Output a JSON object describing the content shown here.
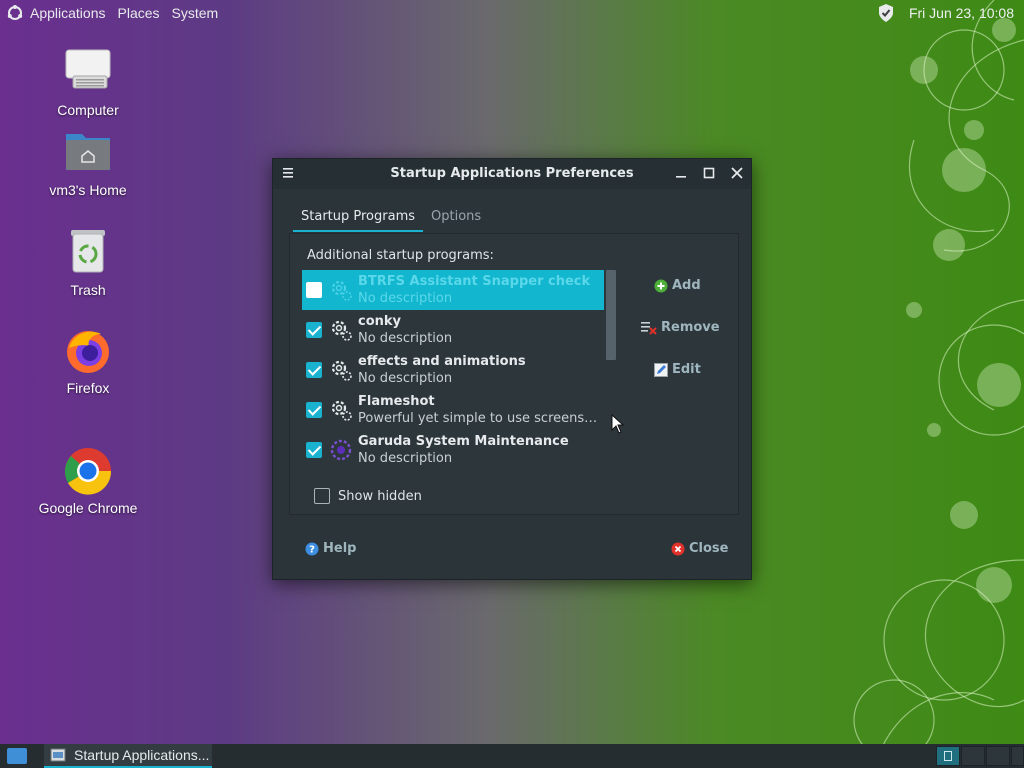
{
  "top_panel": {
    "menus": [
      "Applications",
      "Places",
      "System"
    ],
    "clock": "Fri Jun 23, 10:08"
  },
  "desktop_icons": [
    {
      "label": "Computer"
    },
    {
      "label": "vm3's Home"
    },
    {
      "label": "Trash"
    },
    {
      "label": "Firefox"
    },
    {
      "label": "Google Chrome"
    }
  ],
  "dialog": {
    "title": "Startup Applications Preferences",
    "tabs": [
      "Startup Programs",
      "Options"
    ],
    "active_tab": "Startup Programs",
    "section_label": "Additional startup programs:",
    "programs": [
      {
        "name": "BTRFS Assistant Snapper check",
        "description": "No description",
        "enabled": false,
        "selected": true
      },
      {
        "name": "conky",
        "description": "No description",
        "enabled": true,
        "selected": false
      },
      {
        "name": "effects and animations",
        "description": "No description",
        "enabled": true,
        "selected": false
      },
      {
        "name": "Flameshot",
        "description": "Powerful yet simple to use screenshot software",
        "enabled": true,
        "selected": false
      },
      {
        "name": "Garuda System Maintenance",
        "description": "No description",
        "enabled": true,
        "selected": false
      }
    ],
    "buttons": {
      "add": "Add",
      "remove": "Remove",
      "edit": "Edit"
    },
    "show_hidden_label": "Show hidden",
    "show_hidden_checked": false,
    "help_label": "Help",
    "close_label": "Close"
  },
  "taskbar": {
    "task_label": "Startup Applications..."
  },
  "colors": {
    "accent": "#19b3d0",
    "dialog_bg": "#2a3439",
    "selection": "#12b6cf"
  }
}
